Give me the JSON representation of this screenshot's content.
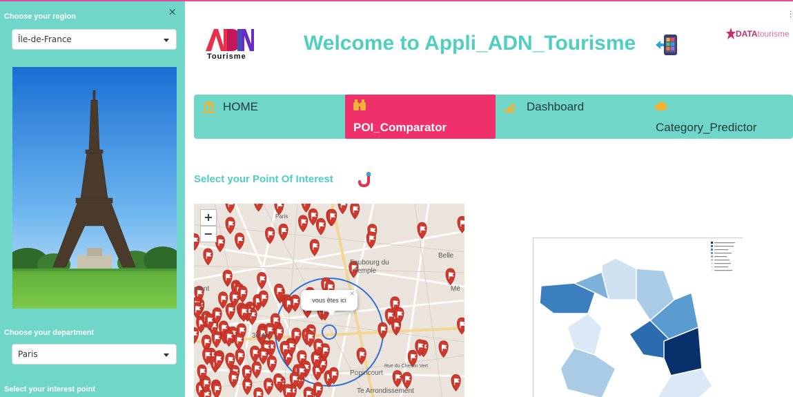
{
  "sidebar": {
    "region_label": "Choose your region",
    "region_value": "Île-de-France",
    "department_label": "Choose your department",
    "department_value": "Paris",
    "interest_label": "Select your interest point",
    "close_glyph": "×"
  },
  "header": {
    "logo_adn": "ADN",
    "logo_tourisme": "Tourisme",
    "welcome": "Welcome to Appli_ADN_Tourisme",
    "datatourisme_bold": "DATA",
    "datatourisme_light": "tourisme"
  },
  "nav": {
    "tabs": [
      {
        "label": "HOME",
        "icon": "bank-icon"
      },
      {
        "label": "POI_Comparator",
        "icon": "binoculars-icon",
        "active": true
      },
      {
        "label": "Dashboard",
        "icon": "bar-chart-icon"
      },
      {
        "label": "Category_Predictor",
        "icon": "cloud-icon"
      }
    ]
  },
  "poi": {
    "title": "Select your Point Of Interest"
  },
  "map": {
    "zoom_in": "+",
    "zoom_out": "−",
    "popup_text": "vous êtes ici",
    "popup_close": "×",
    "labels": [
      "Faubourg du",
      "Temple",
      "3e Arr",
      "Popincourt",
      "Rue du Chemin Vert",
      "Te Arrondissement",
      "Belle",
      "Mé",
      "Paris",
      "ment"
    ]
  },
  "colors": {
    "teal": "#6fd6c8",
    "title_teal": "#50cfc0",
    "active_tab": "#f0306a",
    "marker": "#d0392e"
  }
}
